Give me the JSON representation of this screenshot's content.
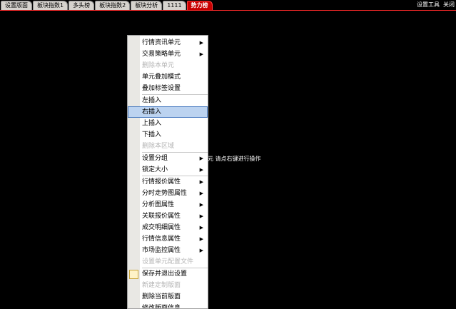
{
  "tabs": [
    {
      "label": "设置版面",
      "active": false
    },
    {
      "label": "板块指数1",
      "active": false
    },
    {
      "label": "多头榜",
      "active": false
    },
    {
      "label": "板块指数2",
      "active": false
    },
    {
      "label": "板块分析",
      "active": false
    },
    {
      "label": "1111",
      "active": false
    },
    {
      "label": "势力榜",
      "active": true
    }
  ],
  "toolbar": {
    "tools_label": "设置工具",
    "close_label": "关闭"
  },
  "hint_text": "元 请点右键进行操作",
  "menu": {
    "groups": [
      [
        {
          "label": "行情资讯单元",
          "submenu": true,
          "disabled": false
        },
        {
          "label": "交易策略单元",
          "submenu": true,
          "disabled": false
        },
        {
          "label": "删除本单元",
          "submenu": false,
          "disabled": true
        },
        {
          "label": "单元叠加模式",
          "submenu": false,
          "disabled": false
        },
        {
          "label": "叠加标签设置",
          "submenu": false,
          "disabled": false
        }
      ],
      [
        {
          "label": "左插入",
          "submenu": false,
          "disabled": false
        },
        {
          "label": "右插入",
          "submenu": false,
          "disabled": false,
          "highlight": true
        },
        {
          "label": "上插入",
          "submenu": false,
          "disabled": false
        },
        {
          "label": "下插入",
          "submenu": false,
          "disabled": false
        },
        {
          "label": "删除本区域",
          "submenu": false,
          "disabled": true
        }
      ],
      [
        {
          "label": "设置分组",
          "submenu": true,
          "disabled": false
        },
        {
          "label": "锁定大小",
          "submenu": true,
          "disabled": false
        }
      ],
      [
        {
          "label": "行情报价属性",
          "submenu": true,
          "disabled": false
        },
        {
          "label": "分时走势图属性",
          "submenu": true,
          "disabled": false
        },
        {
          "label": "分析图属性",
          "submenu": true,
          "disabled": false
        },
        {
          "label": "关联报价属性",
          "submenu": true,
          "disabled": false
        },
        {
          "label": "成交明细属性",
          "submenu": true,
          "disabled": false
        },
        {
          "label": "行情信息属性",
          "submenu": true,
          "disabled": false
        },
        {
          "label": "市场监控属性",
          "submenu": true,
          "disabled": false
        },
        {
          "label": "设置单元配置文件",
          "submenu": false,
          "disabled": true
        }
      ],
      [
        {
          "label": "保存并退出设置",
          "submenu": false,
          "disabled": false,
          "icon": "calendar-icon"
        },
        {
          "label": "新建定制版面",
          "submenu": false,
          "disabled": true
        },
        {
          "label": "删除当前版面",
          "submenu": false,
          "disabled": false
        },
        {
          "label": "修改版面信息",
          "submenu": false,
          "disabled": false
        }
      ]
    ]
  }
}
